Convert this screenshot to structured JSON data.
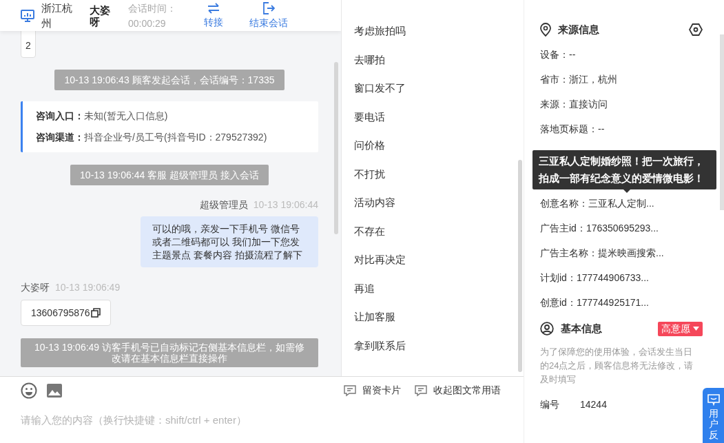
{
  "header": {
    "location": "浙江杭州",
    "visitor": "大姿呀",
    "timer_label": "会话时间：",
    "timer": "00:00:29",
    "actions": [
      {
        "kind": "transfer",
        "label": "转接"
      },
      {
        "kind": "end",
        "label": "结束会话"
      }
    ]
  },
  "messages": [
    {
      "kind": "card",
      "text": "2"
    },
    {
      "kind": "system",
      "text": "10-13 19:06:43 顾客发起会话，会话编号：17335"
    },
    {
      "kind": "info",
      "rows": [
        {
          "label": "咨询入口：",
          "value": "未知(暂无入口信息)"
        },
        {
          "label": "咨询渠道：",
          "value": "抖音企业号/员工号(抖音号ID：279527392)"
        }
      ]
    },
    {
      "kind": "system",
      "text": "10-13 19:06:44 客服 超级管理员 接入会话"
    },
    {
      "kind": "outgoing",
      "sender": "超级管理员",
      "time": "10-13 19:06:44",
      "text": "可以的哦，亲发一下手机号 微信号或者二维码都可以 我们加一下您发主题景点 套餐内容 拍摄流程了解下"
    },
    {
      "kind": "incoming",
      "sender": "大姿呀",
      "time": "10-13 19:06:49",
      "text": "13606795876"
    },
    {
      "kind": "system",
      "text": "10-13 19:06:49 访客手机号已自动标记右侧基本信息栏，如需修改请在基本信息栏直接操作"
    }
  ],
  "phrases": [
    "考虑旅拍吗",
    "去哪拍",
    "窗口发不了",
    "要电话",
    "问价格",
    "不打扰",
    "活动内容",
    "不存在",
    "对比再决定",
    "再追",
    "让加客服",
    "拿到联系后"
  ],
  "composer": {
    "tools": [
      {
        "label": "留资卡片"
      },
      {
        "label": "收起图文常用语"
      }
    ],
    "placeholder": "请输入您的内容（换行快捷键：shift/ctrl + enter）"
  },
  "source_info": {
    "title": "来源信息",
    "rows": [
      "设备：--",
      "省市：浙江，杭州",
      "来源：直接访问",
      "落地页标题：--",
      "创意名称：三亚私人定制...",
      "广告主id：176350695293...",
      "广告主名称：提米映画搜索...",
      "计划id：177744906733...",
      "创意id：177744925171..."
    ],
    "tooltip": "三亚私人定制婚纱照！把一次旅行，拍成一部有纪念意义的爱情微电影！"
  },
  "basic_info": {
    "title": "基本信息",
    "intent": "高意愿",
    "note": "为了保障您的使用体验，会话发生当日的24点之后，顾客信息将无法修改，请及时填写",
    "fields": [
      {
        "label": "编号",
        "value": "14244"
      }
    ]
  },
  "feedback_button": {
    "label": "用户反"
  }
}
